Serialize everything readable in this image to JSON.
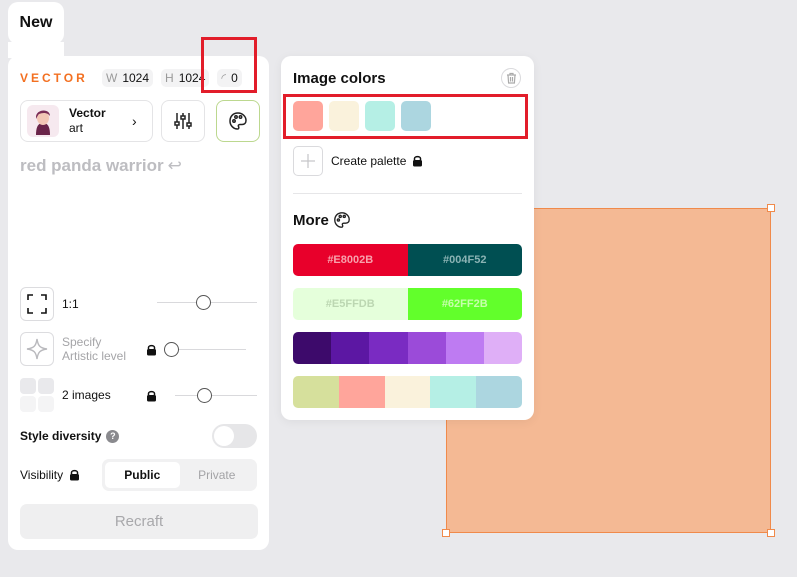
{
  "tab": {
    "label": "New"
  },
  "left": {
    "style_type": "VECTOR",
    "width": {
      "key": "W",
      "value": "1024"
    },
    "height": {
      "key": "H",
      "value": "1024"
    },
    "seed": {
      "value": "0"
    },
    "style": {
      "line1": "Vector",
      "line2": "art"
    },
    "prompt": "red panda warrior",
    "aspect": {
      "label": "1:1"
    },
    "artistic": {
      "line1": "Specify",
      "line2": "Artistic level"
    },
    "images": {
      "label": "2 images"
    },
    "diversity": {
      "label": "Style diversity"
    },
    "visibility": {
      "label": "Visibility",
      "options": [
        "Public",
        "Private"
      ],
      "selected": "Public"
    },
    "recraft_label": "Recraft"
  },
  "popover": {
    "title": "Image colors",
    "image_colors": [
      "#FFA59B",
      "#FAF2DC",
      "#B5EFE5",
      "#ACD6E0"
    ],
    "create_label": "Create palette",
    "more_label": "More",
    "palettes": [
      [
        {
          "hex": "#E8002B",
          "label": "#E8002B",
          "text": "#f7a1ac"
        },
        {
          "hex": "#004F52",
          "label": "#004F52",
          "text": "#8bb3b4"
        }
      ],
      [
        {
          "hex": "#E5FFDB",
          "label": "#E5FFDB",
          "text": "#bcd7b2"
        },
        {
          "hex": "#62FF2B",
          "label": "#62FF2B",
          "text": "#c6ffac"
        }
      ],
      [
        {
          "hex": "#3D0A6B"
        },
        {
          "hex": "#5C17A3"
        },
        {
          "hex": "#7A2BC2"
        },
        {
          "hex": "#9B4BD9"
        },
        {
          "hex": "#BE7BF2"
        },
        {
          "hex": "#DFAFF7"
        }
      ],
      [
        {
          "hex": "#D6E09C"
        },
        {
          "hex": "#FFA59B"
        },
        {
          "hex": "#FAF2DC"
        },
        {
          "hex": "#B5EFE5"
        },
        {
          "hex": "#ACD6E0"
        }
      ]
    ]
  },
  "canvas": {
    "fill": "#F4B994",
    "stroke": "#F08A4B"
  },
  "highlight_color": "#E21D2A"
}
